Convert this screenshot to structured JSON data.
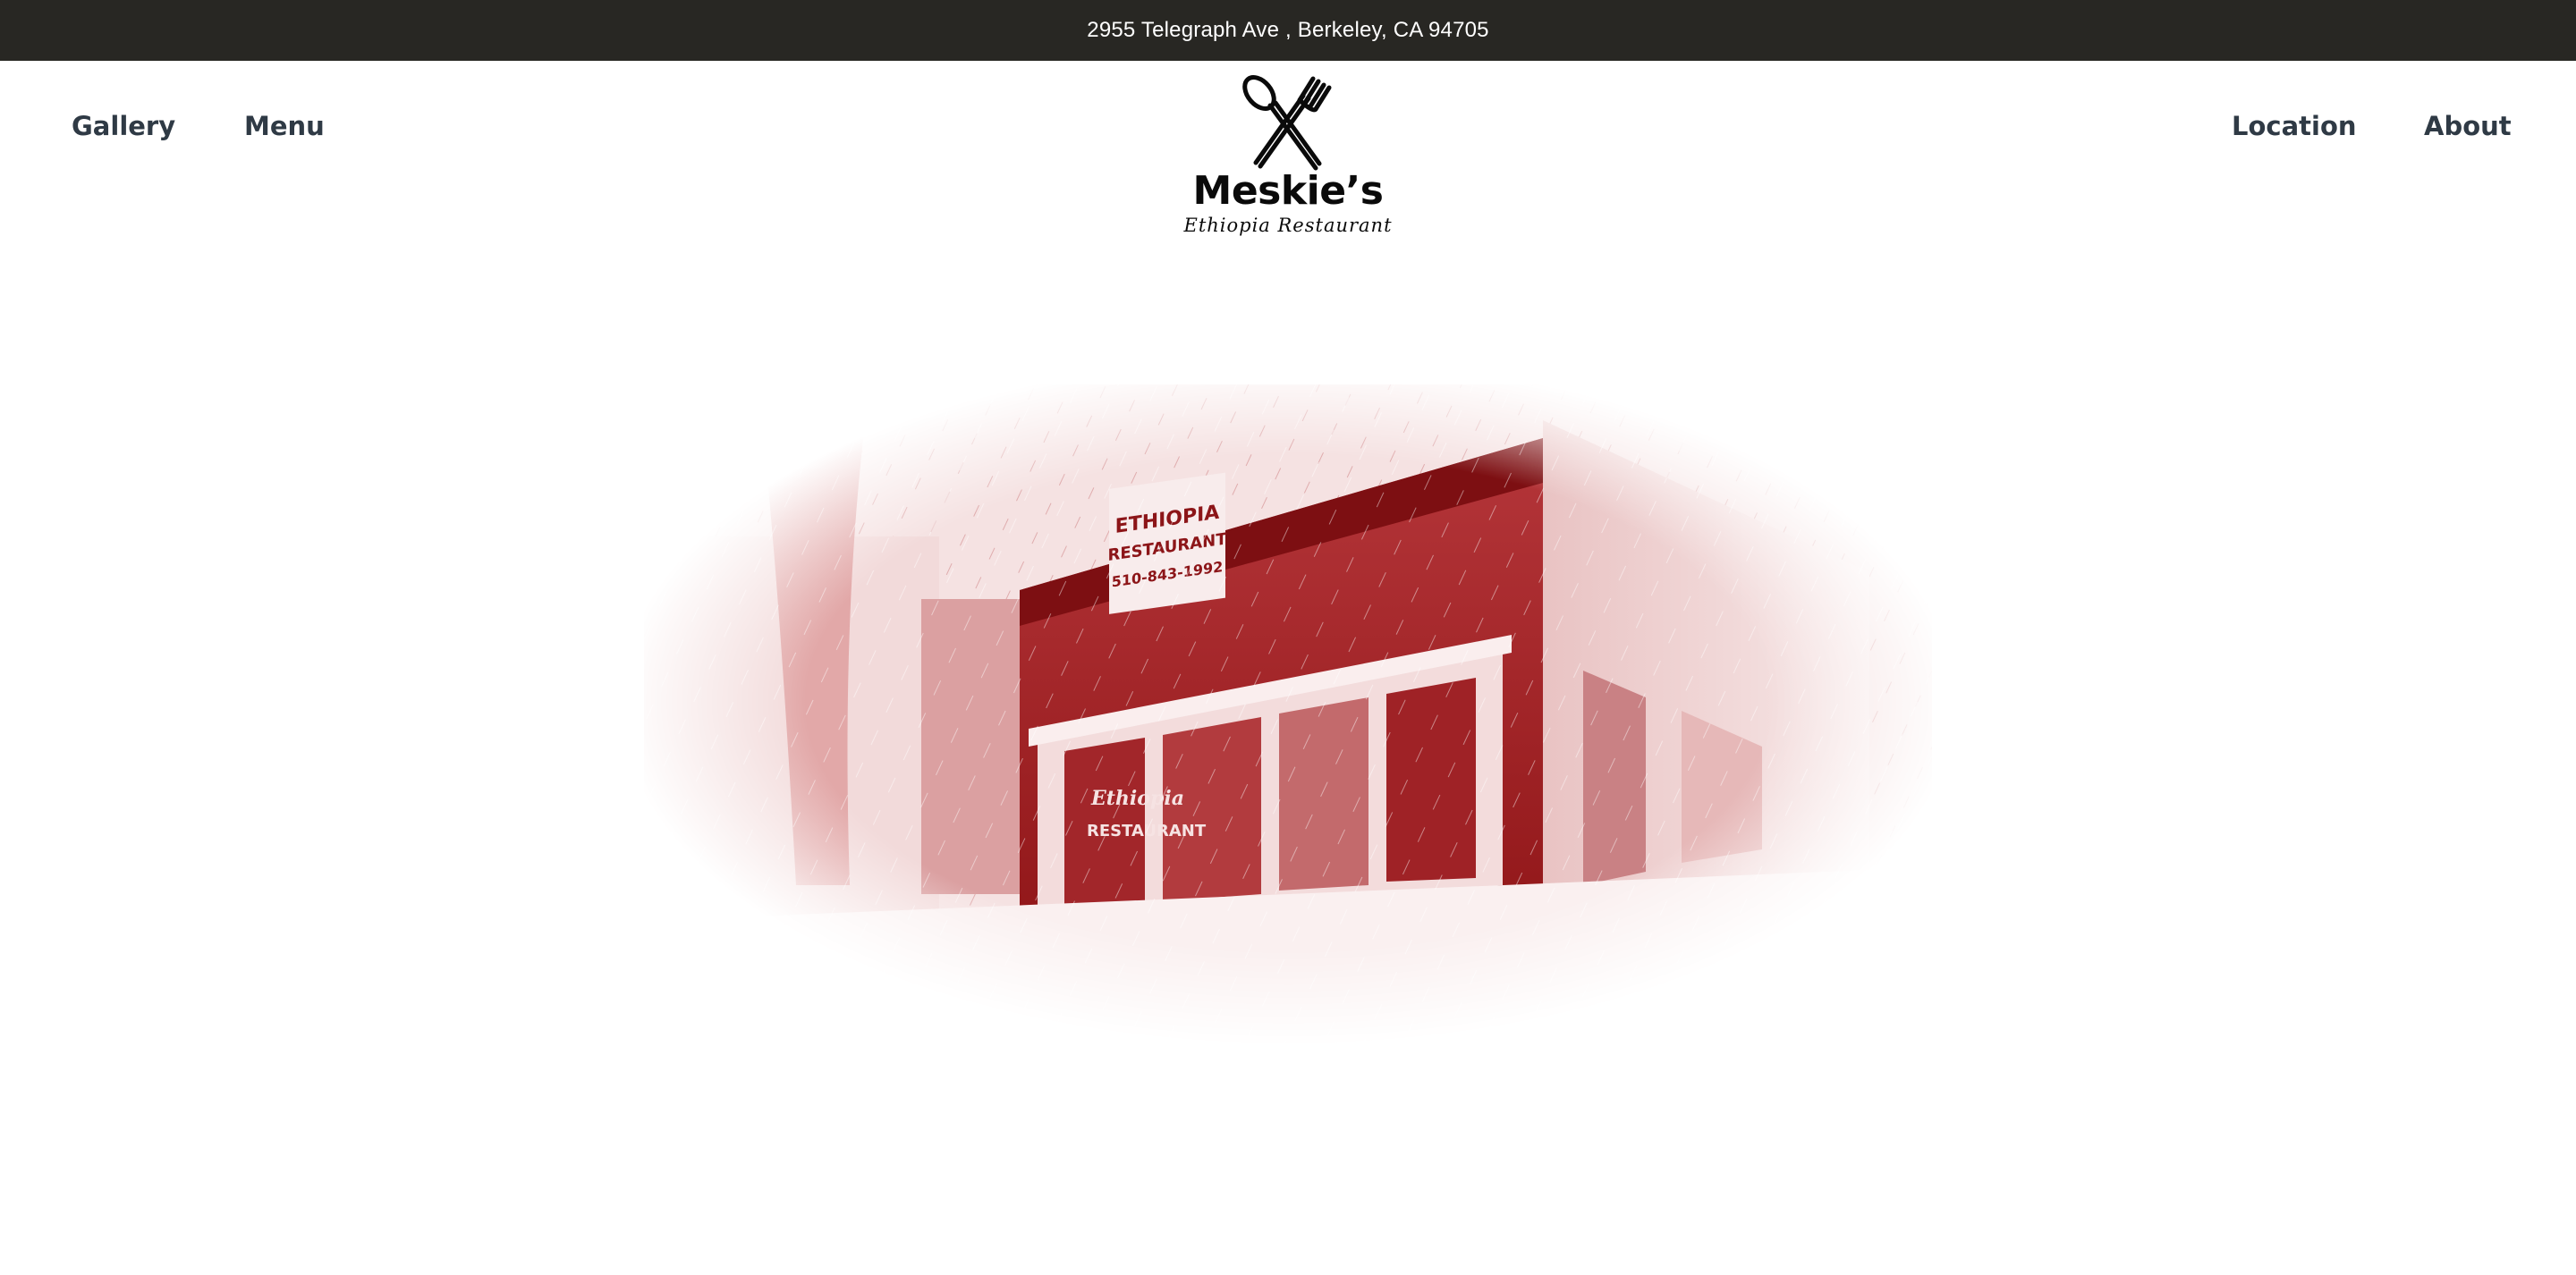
{
  "topbar": {
    "address": "2955 Telegraph Ave , Berkeley, CA 94705"
  },
  "nav": {
    "left": [
      {
        "label": "Gallery"
      },
      {
        "label": "Menu"
      }
    ],
    "right": [
      {
        "label": "Location"
      },
      {
        "label": "About"
      }
    ]
  },
  "logo": {
    "title": "Meskie’s",
    "subtitle": "Ethiopia Restaurant",
    "icon": "crossed-spoon-fork-icon"
  },
  "hero": {
    "illustration": "restaurant-storefront-illustration",
    "sign_text": [
      "ETHIOPIA",
      "RESTAURANT",
      "510-843-1992"
    ],
    "window_text": [
      "Ethiopia",
      "RESTAURANT"
    ],
    "colors": {
      "accent": "#9b1c1f",
      "topbar": "#282723",
      "nav_text": "#2f3a45"
    }
  }
}
